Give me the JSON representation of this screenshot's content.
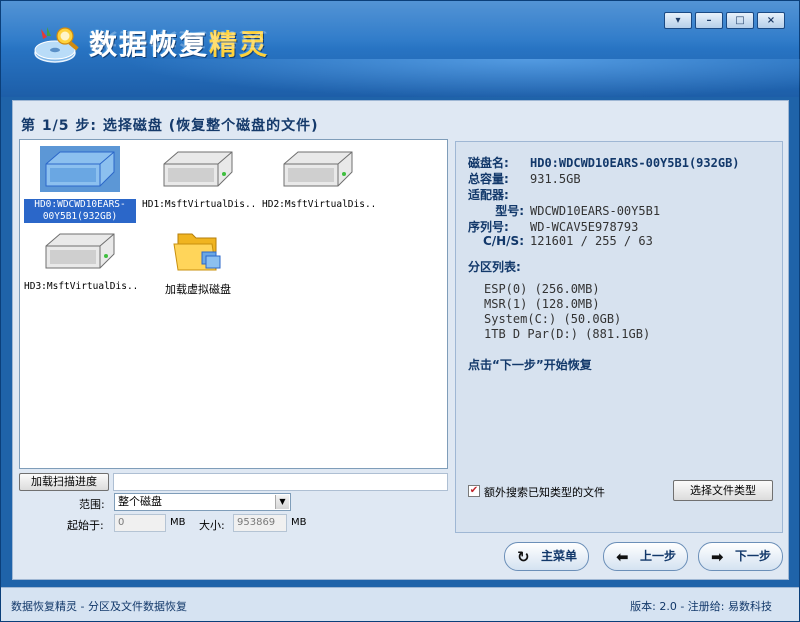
{
  "app": {
    "title_part1": "数据恢复",
    "title_part2": "精灵"
  },
  "window_controls": {
    "menu": "▾",
    "minimize": "–",
    "maximize": "□",
    "close": "×"
  },
  "step": {
    "title": "第 1/5 步: 选择磁盘 (恢复整个磁盘的文件)"
  },
  "disks": [
    {
      "label": "HD0:WDCWD10EARS-00Y5B1(932GB)",
      "selected": true,
      "icon": "hard-disk-icon"
    },
    {
      "label": "HD1:MsftVirtualDis...",
      "selected": false,
      "icon": "hard-disk-icon"
    },
    {
      "label": "HD2:MsftVirtualDis...",
      "selected": false,
      "icon": "hard-disk-icon"
    },
    {
      "label": "HD3:MsftVirtualDis...",
      "selected": false,
      "icon": "hard-disk-icon"
    },
    {
      "label": "加载虚拟磁盘",
      "selected": false,
      "icon": "folder-icon"
    }
  ],
  "scan": {
    "load_progress_label": "加载扫描进度",
    "range_label": "范围:",
    "range_value": "整个磁盘",
    "start_label": "起始于:",
    "start_value": "0",
    "start_unit": "MB",
    "size_label": "大小:",
    "size_value": "953869",
    "size_unit": "MB"
  },
  "disk_info": {
    "name_key": "磁盘名:",
    "name_value": "HD0:WDCWD10EARS-00Y5B1(932GB)",
    "capacity_key": "总容量:",
    "capacity_value": "931.5GB",
    "adapter_key": "适配器:",
    "model_key": "型号:",
    "model_value": "WDCWD10EARS-00Y5B1",
    "serial_key": "序列号:",
    "serial_value": "WD-WCAV5E978793",
    "chs_key": "C/H/S:",
    "chs_value": "121601 / 255 / 63",
    "partition_title": "分区列表:",
    "partitions": [
      "ESP(0) (256.0MB)",
      "MSR(1) (128.0MB)",
      "System(C:) (50.0GB)",
      "1TB D Par(D:) (881.1GB)"
    ],
    "hint": "点击“下一步”开始恢复"
  },
  "options": {
    "extra_search_label": "额外搜索已知类型的文件",
    "extra_search_checked": true,
    "choose_filetype_label": "选择文件类型"
  },
  "nav": {
    "main_menu_label": "主菜单",
    "prev_label": "上一步",
    "next_label": "下一步"
  },
  "status": {
    "left": "数据恢复精灵 - 分区及文件数据恢复",
    "right": "版本: 2.0 - 注册给: 易数科技"
  },
  "colors": {
    "header_blue": "#2a78c8",
    "selection_blue": "#2b67c9",
    "panel_bg": "#d7e2ef",
    "text_dark_blue": "#12386a",
    "title_accent_yellow": "#ffd23c"
  }
}
